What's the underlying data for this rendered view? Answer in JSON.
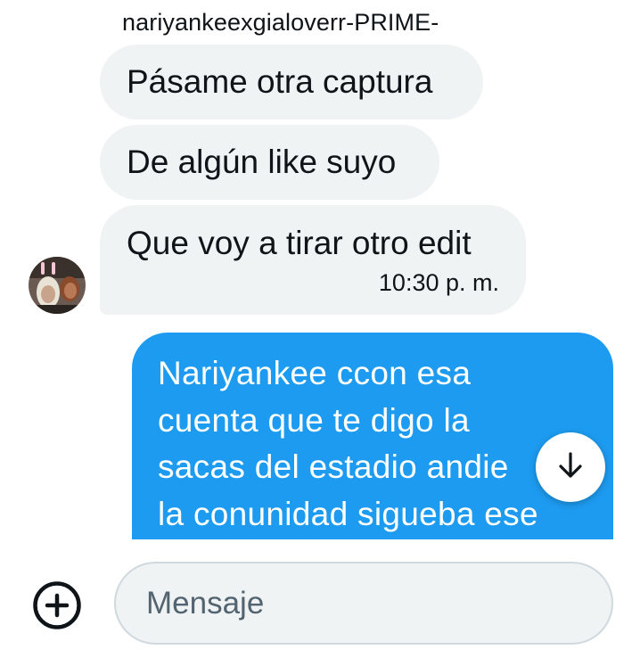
{
  "conversation": {
    "sender_name": "nariyankeexgialoverr-PRIME-",
    "incoming": [
      {
        "text": "Pásame otra captura"
      },
      {
        "text": "De algún like suyo"
      },
      {
        "text": "Que voy a tirar otro edit",
        "time": "10:30 p. m."
      }
    ],
    "outgoing": {
      "lines": [
        "Nariyankee ccon esa",
        "cuenta que te digo la",
        "sacas del estadio andie",
        "la conunidad sigueba ese"
      ]
    }
  },
  "composer": {
    "placeholder": "Mensaje",
    "value": ""
  },
  "icons": {
    "add": "plus-circle-icon",
    "scroll": "arrow-down-icon"
  },
  "colors": {
    "accent": "#1d9bf0",
    "incoming_bubble": "#eff3f4",
    "text": "#0f1419",
    "placeholder": "#536471"
  }
}
